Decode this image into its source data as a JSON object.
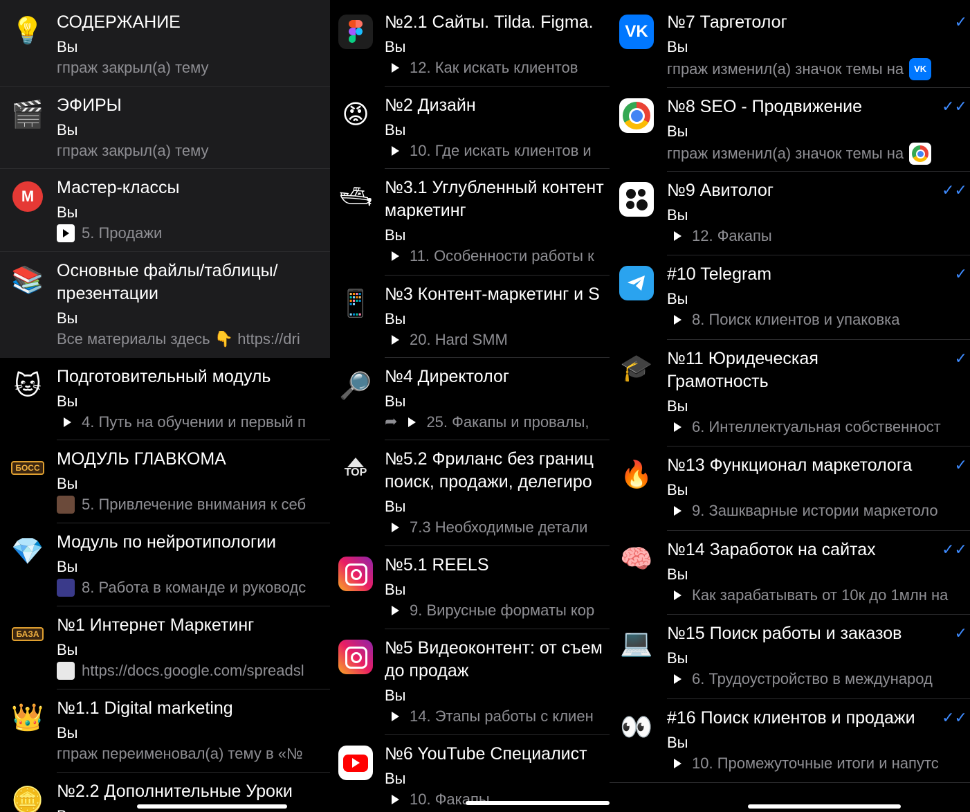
{
  "col1": {
    "rows": [
      {
        "icon": "💡",
        "title": "СОДЕРЖАНИЕ",
        "sender": "Вы",
        "preview": "гпраж закрыл(а) тему"
      },
      {
        "icon": "🎬",
        "title": "ЭФИРЫ",
        "sender": "Вы",
        "preview": "гпраж закрыл(а) тему"
      },
      {
        "icon": "Ⓜ",
        "title": "Мастер-классы",
        "sender": "Вы",
        "preview": "5. Продажи"
      },
      {
        "icon": "📚",
        "title_line1": "Основные файлы/таблицы/",
        "title_line2": "презентации",
        "sender": "Вы",
        "preview": "Все материалы здесь 👇 https://dri"
      },
      {
        "icon": "🐱",
        "title": "Подготовительный модуль",
        "sender": "Вы",
        "preview": "4. Путь на обучении и первый п"
      },
      {
        "icon": "БОСС",
        "title": "МОДУЛЬ ГЛАВКОМА",
        "sender": "Вы",
        "preview": "5. Привлечение внимания к себ"
      },
      {
        "icon": "💎",
        "title": "Модуль по нейротипологии",
        "sender": "Вы",
        "preview": "8. Работа в команде и руководс"
      },
      {
        "icon": "БАЗА",
        "title": "№1 Интернет Маркетинг",
        "sender": "Вы",
        "preview": "https://docs.google.com/spreadsl"
      },
      {
        "icon": "👑",
        "title": "№1.1 Digital marketing",
        "sender": "Вы",
        "preview": "гпраж переименовал(а) тему в «№"
      },
      {
        "icon": "🪙",
        "title": "№2.2 Дополнительные Уроки",
        "sender": "Вы",
        "preview": ""
      }
    ]
  },
  "col2": {
    "rows": [
      {
        "icon": "figma-icon",
        "title": "№2.1 Сайты. Tilda. Figma.",
        "sender": "Вы",
        "preview": "12. Как искать клиентов"
      },
      {
        "icon": "😡",
        "title": "№2 Дизайн",
        "sender": "Вы",
        "preview": "10. Где искать клиентов и"
      },
      {
        "icon": "🛥",
        "title_line1": "№3.1 Углубленный контент",
        "title_line2": "маркетинг",
        "sender": "Вы",
        "preview": "11. Особенности работы к"
      },
      {
        "icon": "📱",
        "title": "№3 Контент-маркетинг и S",
        "sender": "Вы",
        "preview": "20. Hard SMM"
      },
      {
        "icon": "🔎",
        "title": "№4 Директолог",
        "sender": "Вы",
        "preview": "25. Факапы и провалы,"
      },
      {
        "icon": "TOP",
        "title_line1": "№5.2 Фриланс без границ",
        "title_line2": "поиск, продажи, делегиро",
        "sender": "Вы",
        "preview": "7.3 Необходимые детали"
      },
      {
        "icon": "instagram-icon",
        "title": "№5.1 REELS",
        "sender": "Вы",
        "preview": "9. Вирусные форматы кор"
      },
      {
        "icon": "instagram-icon",
        "title_line1": "№5 Видеоконтент: от съем",
        "title_line2": "до продаж",
        "sender": "Вы",
        "preview": "14. Этапы работы с клиен"
      },
      {
        "icon": "youtube-icon",
        "title": "№6 YouTube Специалист",
        "sender": "Вы",
        "preview": "10. Факапы"
      }
    ]
  },
  "col3": {
    "rows": [
      {
        "icon": "vk-icon",
        "title": "№7 Таргетолог",
        "sender": "Вы",
        "preview": "гпраж изменил(а) значок темы на",
        "check": "✓"
      },
      {
        "icon": "chrome-icon",
        "title": "№8 SEO - Продвижение",
        "sender": "Вы",
        "preview": "гпраж изменил(а) значок темы на",
        "check": "✓✓"
      },
      {
        "icon": "dots-icon",
        "title": "№9 Авитолог",
        "sender": "Вы",
        "preview": "12. Факапы",
        "check": "✓✓"
      },
      {
        "icon": "telegram-icon",
        "title": "#10 Telegram",
        "sender": "Вы",
        "preview": "8. Поиск клиентов и упаковка",
        "check": "✓"
      },
      {
        "icon": "🎓",
        "title_line1": "№11 Юридеческая",
        "title_line2": "Грамотность",
        "sender": "Вы",
        "preview": "6. Интеллектуальная собственност",
        "check": "✓"
      },
      {
        "icon": "🔥",
        "title": "№13 Функционал маркетолога",
        "sender": "Вы",
        "preview": "9. Зашкварные истории маркетоло",
        "check": "✓"
      },
      {
        "icon": "🧠",
        "title": "№14 Заработок на сайтах",
        "sender": "Вы",
        "preview": "Как зарабатывать от 10к до 1млн на",
        "check": "✓✓"
      },
      {
        "icon": "💻",
        "title": "№15 Поиск работы и заказов",
        "sender": "Вы",
        "preview": "6. Трудоустройство в международ",
        "check": "✓"
      },
      {
        "icon": "👀",
        "title": "#16 Поиск клиентов и продажи",
        "sender": "Вы",
        "preview": "10. Промежуточные итоги и напутс",
        "check": "✓✓"
      }
    ]
  }
}
